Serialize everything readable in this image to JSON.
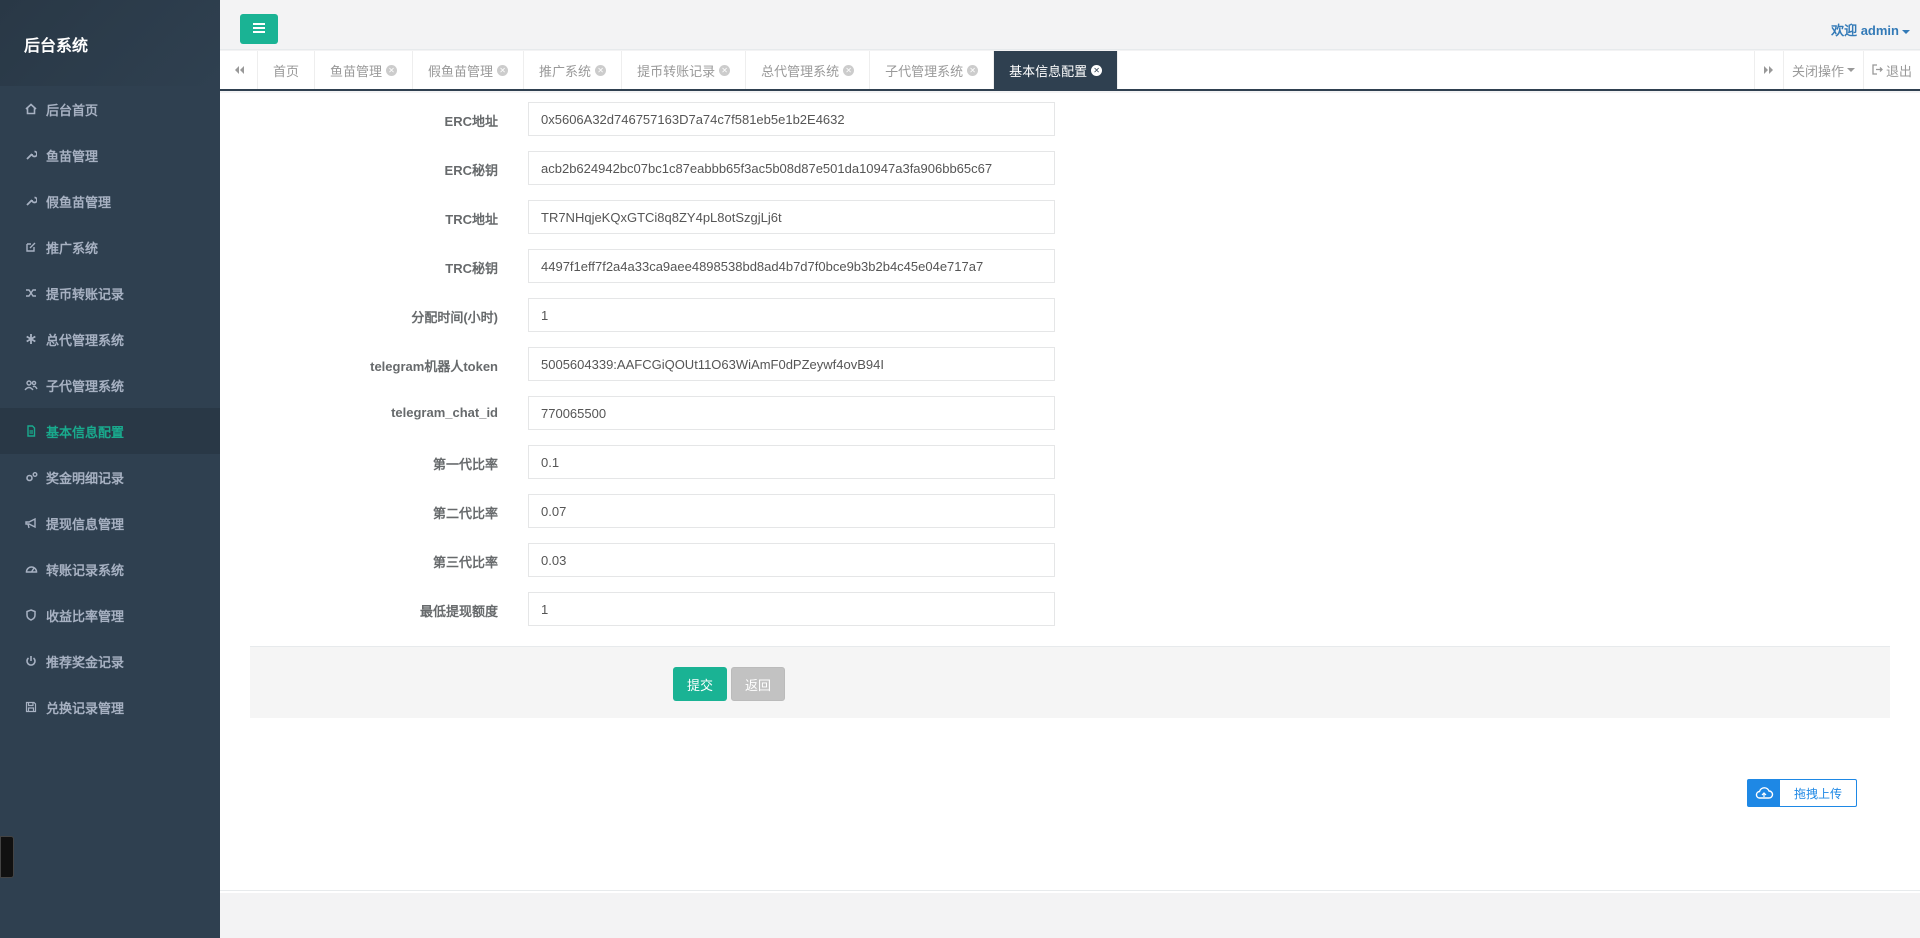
{
  "sidebar": {
    "title": "后台系统",
    "items": [
      {
        "label": "后台首页",
        "icon": "home-icon"
      },
      {
        "label": "鱼苗管理",
        "icon": "wrench-icon"
      },
      {
        "label": "假鱼苗管理",
        "icon": "wrench-icon"
      },
      {
        "label": "推广系统",
        "icon": "edit-icon"
      },
      {
        "label": "提币转账记录",
        "icon": "random-icon"
      },
      {
        "label": "总代管理系统",
        "icon": "asterisk-icon"
      },
      {
        "label": "子代管理系统",
        "icon": "users-icon"
      },
      {
        "label": "基本信息配置",
        "icon": "file-icon"
      },
      {
        "label": "奖金明细记录",
        "icon": "cogs-icon"
      },
      {
        "label": "提现信息管理",
        "icon": "bullhorn-icon"
      },
      {
        "label": "转账记录系统",
        "icon": "dashboard-icon"
      },
      {
        "label": "收益比率管理",
        "icon": "shield-icon"
      },
      {
        "label": "推荐奖金记录",
        "icon": "power-icon"
      },
      {
        "label": "兑换记录管理",
        "icon": "save-icon"
      }
    ]
  },
  "header": {
    "welcome": "欢迎 admin"
  },
  "tabs": {
    "items": [
      "首页",
      "鱼苗管理",
      "假鱼苗管理",
      "推广系统",
      "提币转账记录",
      "总代管理系统",
      "子代管理系统",
      "基本信息配置"
    ],
    "close_action": "关闭操作",
    "logout": "退出"
  },
  "form": {
    "fields": [
      {
        "label": "ERC地址",
        "value": "0x5606A32d746757163D7a74c7f581eb5e1b2E4632"
      },
      {
        "label": "ERC秘钥",
        "value": "acb2b624942bc07bc1c87eabbb65f3ac5b08d87e501da10947a3fa906bb65c67"
      },
      {
        "label": "TRC地址",
        "value": "TR7NHqjeKQxGTCi8q8ZY4pL8otSzgjLj6t"
      },
      {
        "label": "TRC秘钥",
        "value": "4497f1eff7f2a4a33ca9aee4898538bd8ad4b7d7f0bce9b3b2b4c45e04e717a7"
      },
      {
        "label": "分配时间(小时)",
        "value": "1"
      },
      {
        "label": "telegram机器人token",
        "value": "5005604339:AAFCGiQOUt11O63WiAmF0dPZeywf4ovB94I"
      },
      {
        "label": "telegram_chat_id",
        "value": "770065500"
      },
      {
        "label": "第一代比率",
        "value": "0.1"
      },
      {
        "label": "第二代比率",
        "value": "0.07"
      },
      {
        "label": "第三代比率",
        "value": "0.03"
      },
      {
        "label": "最低提现额度",
        "value": "1"
      }
    ],
    "submit": "提交",
    "back": "返回"
  },
  "upload": {
    "label": "拖拽上传"
  },
  "colors": {
    "sidebar_bg": "#2f4050",
    "accent": "#1ab394",
    "link": "#337ab7",
    "upload": "#1e88e5"
  }
}
